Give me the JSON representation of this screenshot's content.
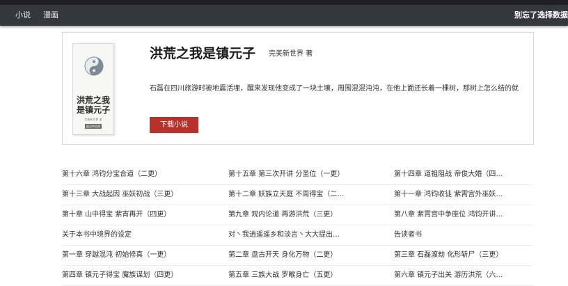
{
  "nav": {
    "novel_label": "小说",
    "comic_label": "漫画",
    "right_label": "别忘了选择数据源"
  },
  "cover": {
    "title_line1": "洪荒之我",
    "title_line2": "是镇元子",
    "author": "完美新世界 著",
    "publisher": "起点中文网",
    "icon": "yin-yang-icon"
  },
  "book": {
    "title": "洪荒之我是镇元子",
    "author": "完美新世界 著",
    "description": "石磊在四川旅游时被地震活埋，醒来发现他变成了一块土壤，周围混混沌沌，在他上面还长着一棵树，那树上怎么结的就",
    "download_label": "下载小说"
  },
  "chapters": [
    [
      "第十六章 鸿钧分宝合道（二更）",
      "第十五章 第三次开讲 分圣位（一更）",
      "第十四章 道祖阻战 帝俊大婚（四更）"
    ],
    [
      "第十三章 大战起因 巫妖初战（三更）",
      "第十二章 妖族立天庭 不周得宝（二…",
      "第十一章 鸿钧收徒 紫霄宫外巫妖争…"
    ],
    [
      "第十章 山中得宝 紫宵再开（四更）",
      "第九章 观内论道 再游洪荒（三更）",
      "第八章 紫霄宫中争座位 鸿钧开讲（…"
    ],
    [
      "关于本书中境界的设定",
      "对丶我逍遥遥乡和淡言丶大大提出问…",
      "告读者书"
    ],
    [
      "第一章 穿越混沌 初始修真（一更）",
      "第二章 盘古开天 身化万物（二更）",
      "第三章 石磊渡劫 化形斩尸（三更）"
    ],
    [
      "第四章 镇元子得宝 魔族谋划（四更）",
      "第五章 三族大战 罗睺身亡（五更）",
      "第六章 镇元子出关 游历洪荒（六更）"
    ]
  ]
}
